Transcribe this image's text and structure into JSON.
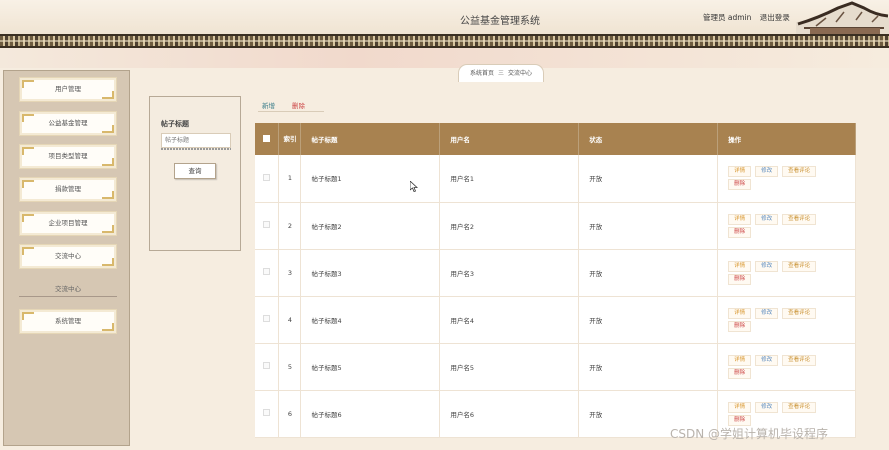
{
  "header": {
    "title": "公益基金管理系统",
    "user_label": "管理员 admin",
    "logout_label": "退出登录"
  },
  "sidebar": {
    "items": [
      {
        "label": "用户管理"
      },
      {
        "label": "公益基金管理"
      },
      {
        "label": "项目类型管理"
      },
      {
        "label": "捐款管理"
      },
      {
        "label": "企业项目管理"
      },
      {
        "label": "交流中心"
      },
      {
        "label": "系统管理"
      }
    ],
    "submenu_label": "交流中心"
  },
  "breadcrumb": {
    "home": "系统首页",
    "separator": "三",
    "current": "交流中心"
  },
  "search": {
    "label": "帖子标题",
    "placeholder": "帖子标题",
    "button": "查询"
  },
  "actions": {
    "add": "新增",
    "delete": "删除"
  },
  "table": {
    "columns": [
      "",
      "索引",
      "帖子标题",
      "用户名",
      "状态",
      "操作"
    ],
    "op_labels": {
      "detail": "详情",
      "edit": "修改",
      "comment": "查看评论",
      "delete": "删除"
    },
    "rows": [
      {
        "index": "1",
        "title": "帖子标题1",
        "username": "用户名1",
        "status": "开放"
      },
      {
        "index": "2",
        "title": "帖子标题2",
        "username": "用户名2",
        "status": "开放"
      },
      {
        "index": "3",
        "title": "帖子标题3",
        "username": "用户名3",
        "status": "开放"
      },
      {
        "index": "4",
        "title": "帖子标题4",
        "username": "用户名4",
        "status": "开放"
      },
      {
        "index": "5",
        "title": "帖子标题5",
        "username": "用户名5",
        "status": "开放"
      },
      {
        "index": "6",
        "title": "帖子标题6",
        "username": "用户名6",
        "status": "开放"
      }
    ]
  },
  "watermark": "CSDN @学姐计算机毕设程序",
  "colors": {
    "table_header": "#a88250",
    "sidebar_bg": "#d6c7b3",
    "page_bg": "#f6ede0"
  }
}
